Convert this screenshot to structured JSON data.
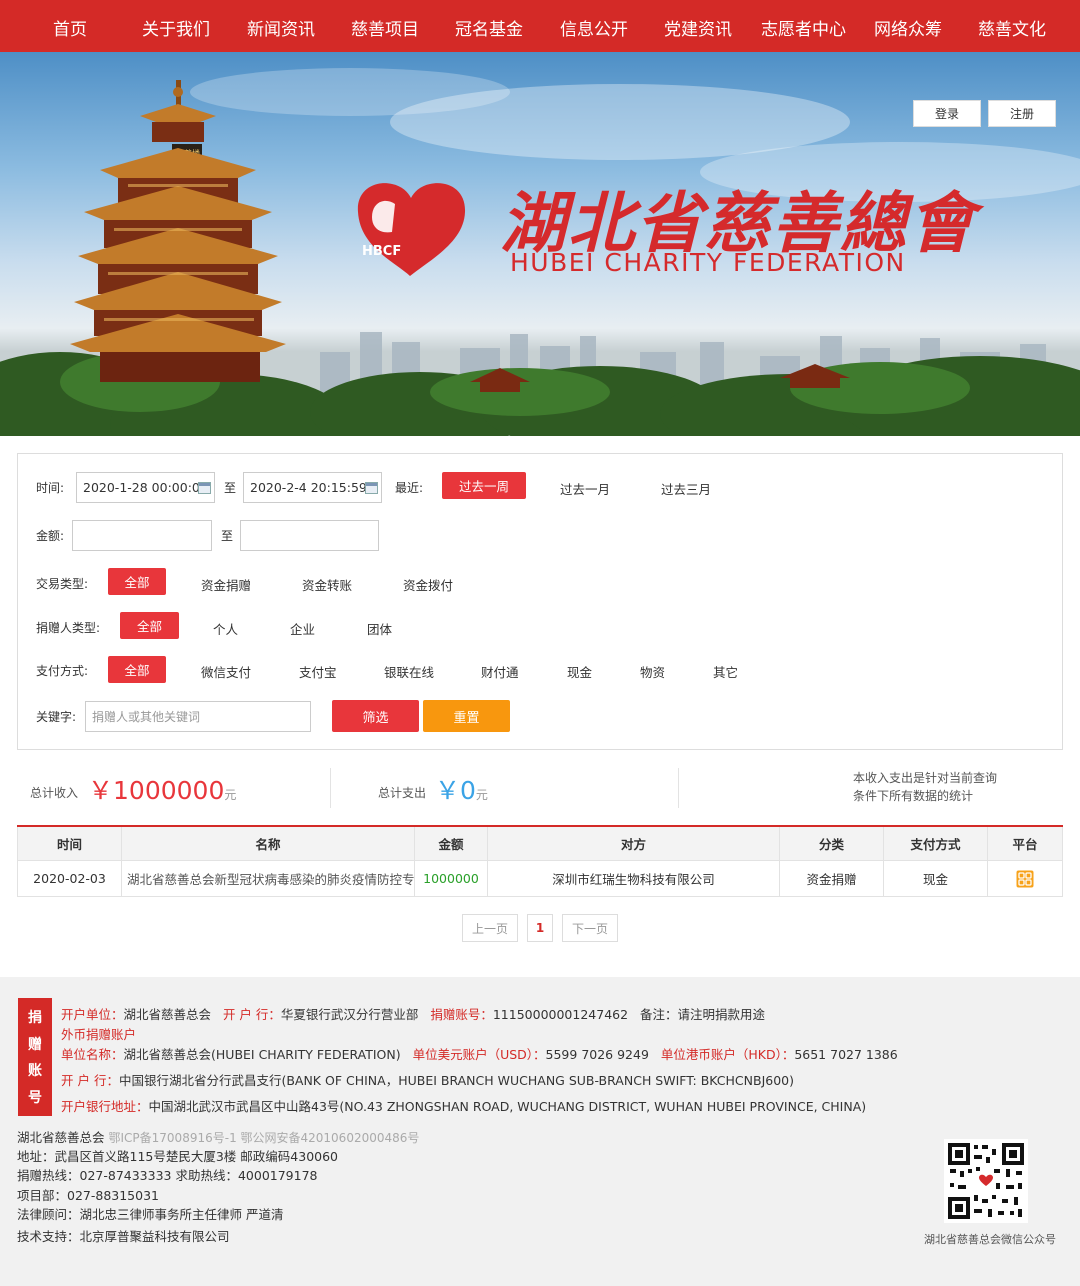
{
  "nav": {
    "items": [
      "首页",
      "关于我们",
      "新闻资讯",
      "慈善项目",
      "冠名基金",
      "信息公开",
      "党建资讯",
      "志愿者中心",
      "网络众筹",
      "慈善文化"
    ]
  },
  "banner": {
    "login": "登录",
    "register": "注册",
    "logo_mark": "HBCF",
    "name_cn": "湖北省慈善總會",
    "name_en": "HUBEI CHARITY FEDERATION",
    "tower_plaque": "黄鹤楼"
  },
  "filter": {
    "time_label": "时间:",
    "time_from": "2020-1-28 00:00:00",
    "to": "至",
    "time_to": "2020-2-4 20:15:59",
    "recent_label": "最近:",
    "recent": [
      "过去一周",
      "过去一月",
      "过去三月"
    ],
    "recent_active": 0,
    "amount_label": "金额:",
    "amount_from": "",
    "amount_to": "",
    "trade_type_label": "交易类型:",
    "trade_types": [
      "全部",
      "资金捐赠",
      "资金转账",
      "资金拨付"
    ],
    "donor_type_label": "捐赠人类型:",
    "donor_types": [
      "全部",
      "个人",
      "企业",
      "团体"
    ],
    "pay_label": "支付方式:",
    "pay_methods": [
      "全部",
      "微信支付",
      "支付宝",
      "银联在线",
      "财付通",
      "现金",
      "物资",
      "其它"
    ],
    "keyword_label": "关键字:",
    "keyword_placeholder": "捐赠人或其他关键词",
    "filter_btn": "筛选",
    "reset_btn": "重置"
  },
  "totals": {
    "income_label": "总计收入",
    "income_currency": "￥",
    "income_value": "1000000",
    "income_unit": "元",
    "expense_label": "总计支出",
    "expense_currency": "￥",
    "expense_value": "0",
    "expense_unit": "元",
    "note_line1": "本收入支出是针对当前查询",
    "note_line2": "条件下所有数据的统计"
  },
  "table": {
    "headers": [
      "时间",
      "名称",
      "金额",
      "对方",
      "分类",
      "支付方式",
      "平台"
    ],
    "rows": [
      [
        "2020-02-03",
        "湖北省慈善总会新型冠状病毒感染的肺炎疫情防控专...",
        "1000000",
        "深圳市红瑞生物科技有限公司",
        "资金捐赠",
        "现金",
        ""
      ]
    ]
  },
  "pager": {
    "prev": "上一页",
    "current": "1",
    "next": "下一页"
  },
  "footer": {
    "tag": [
      "捐",
      "赠",
      "账",
      "号"
    ],
    "line1": {
      "k1": "开户单位：",
      "v1": "湖北省慈善总会",
      "k2": "开 户 行：",
      "v2": "华夏银行武汉分行营业部",
      "k3": "捐赠账号：",
      "v3": "11150000001247462",
      "k4": "备注：",
      "v4": "请注明捐款用途"
    },
    "line2": "外币捐赠账户",
    "line3": {
      "k1": "单位名称：",
      "v1": "湖北省慈善总会(HUBEI CHARITY FEDERATION)",
      "k2": "单位美元账户（USD）：",
      "v2": "5599 7026 9249",
      "k3": "单位港币账户（HKD）：",
      "v3": "5651 7027 1386"
    },
    "line4": {
      "k": "开 户 行：",
      "v": "中国银行湖北省分行武昌支行(BANK OF CHINA，HUBEI BRANCH WUCHANG SUB-BRANCH SWIFT: BKCHCNBJ600)"
    },
    "line5": {
      "k": "开户银行地址：",
      "v": "中国湖北武汉市武昌区中山路43号(NO.43 ZHONGSHAN ROAD, WUCHANG DISTRICT, WUHAN HUBEI PROVINCE, CHINA)"
    },
    "org": "湖北省慈善总会",
    "icp": "鄂ICP备17008916号-1 鄂公网安备42010602000486号",
    "address": "地址：武昌区首义路115号楚民大厦3楼 邮政编码430060",
    "hotline": "捐赠热线：027-87433333 求助热线：4000179178",
    "project": "项目部：027-88315031",
    "legal": "法律顾问：湖北忠三律师事务所主任律师 严道清",
    "tech": "技术支持：北京厚普聚益科技有限公司",
    "qr_caption": "湖北省慈善总会微信公众号"
  }
}
